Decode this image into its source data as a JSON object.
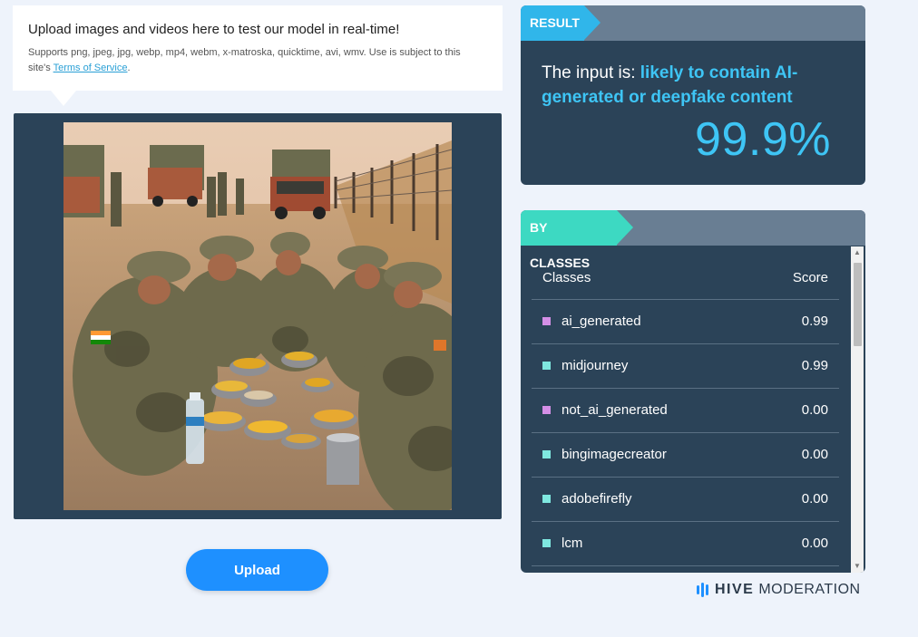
{
  "upload_info": {
    "title": "Upload images and videos here to test our model in real-time!",
    "desc_prefix": "Supports png, jpeg, jpg, webp, mp4, webm, x-matroska, quicktime, avi, wmv. Use is subject to this site's ",
    "tos_link": "Terms of Service",
    "desc_suffix": "."
  },
  "upload_button": {
    "label": "Upload",
    "color": "#1e90ff"
  },
  "result": {
    "tag": "RESULT",
    "prefix": "The input is: ",
    "verdict": "likely to contain AI-generated or deepfake content",
    "score": "99.9%",
    "accent": "#3ec5f5"
  },
  "classes": {
    "tag": "BY CLASSES",
    "header_name": "Classes",
    "header_score": "Score",
    "rows": [
      {
        "name": "ai_generated",
        "score": "0.99",
        "color": "#d48fe6"
      },
      {
        "name": "midjourney",
        "score": "0.99",
        "color": "#7fe8e0"
      },
      {
        "name": "not_ai_generated",
        "score": "0.00",
        "color": "#d48fe6"
      },
      {
        "name": "bingimagecreator",
        "score": "0.00",
        "color": "#7fe8e0"
      },
      {
        "name": "adobefirefly",
        "score": "0.00",
        "color": "#7fe8e0"
      },
      {
        "name": "lcm",
        "score": "0.00",
        "color": "#7fe8e0"
      }
    ]
  },
  "logo": {
    "hive": "HIVE",
    "moderation": "MODERATION",
    "icon": "hive-bars-icon"
  }
}
